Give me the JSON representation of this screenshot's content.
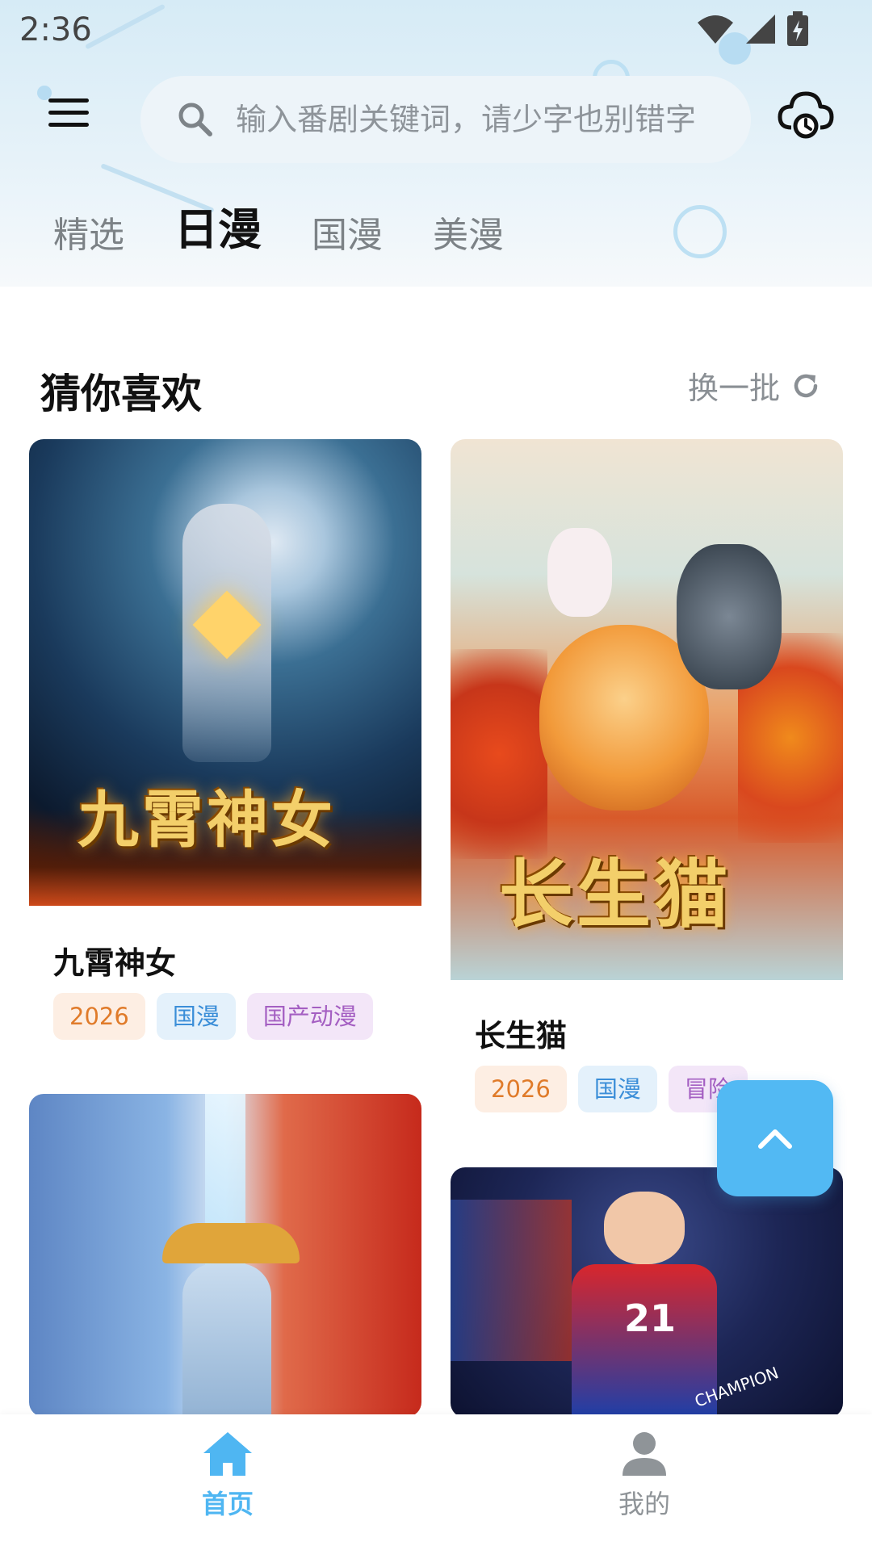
{
  "status_bar": {
    "time": "2:36",
    "icons": [
      "wifi-icon",
      "signal-icon",
      "battery-charging-icon"
    ]
  },
  "top_bar": {
    "menu_icon": "menu-icon",
    "search": {
      "placeholder": "输入番剧关键词，请少字也别错字",
      "value": ""
    },
    "cloud_icon": "cloud-sync-icon"
  },
  "tabs": [
    {
      "label": "精选",
      "active": false
    },
    {
      "label": "日漫",
      "active": true
    },
    {
      "label": "国漫",
      "active": false
    },
    {
      "label": "美漫",
      "active": false
    }
  ],
  "section": {
    "title": "猜你喜欢",
    "refresh_label": "换一批",
    "refresh_icon": "refresh-icon"
  },
  "cards": [
    {
      "title": "九霄神女",
      "cover_text": "九霄神女",
      "tags": [
        "2026",
        "国漫",
        "国产动漫"
      ]
    },
    {
      "title": "长生猫",
      "cover_text": "长生猫",
      "tags": [
        "2026",
        "国漫",
        "冒险"
      ]
    },
    {
      "title": "",
      "cover_text": "",
      "tags": []
    },
    {
      "title": "",
      "cover_text": "CHAMPION",
      "jersey_number": "21",
      "tags": []
    }
  ],
  "back_to_top_icon": "chevron-up-icon",
  "bottom_nav": [
    {
      "label": "首页",
      "icon": "home-icon",
      "active": true
    },
    {
      "label": "我的",
      "icon": "user-icon",
      "active": false
    }
  ],
  "colors": {
    "accent": "#4fb6f2",
    "tab_active": "#111111",
    "tab_inactive": "#7c8286",
    "tag_year": "#e07b2a",
    "tag_type": "#3b8ed8",
    "tag_genre": "#a45fc2"
  }
}
